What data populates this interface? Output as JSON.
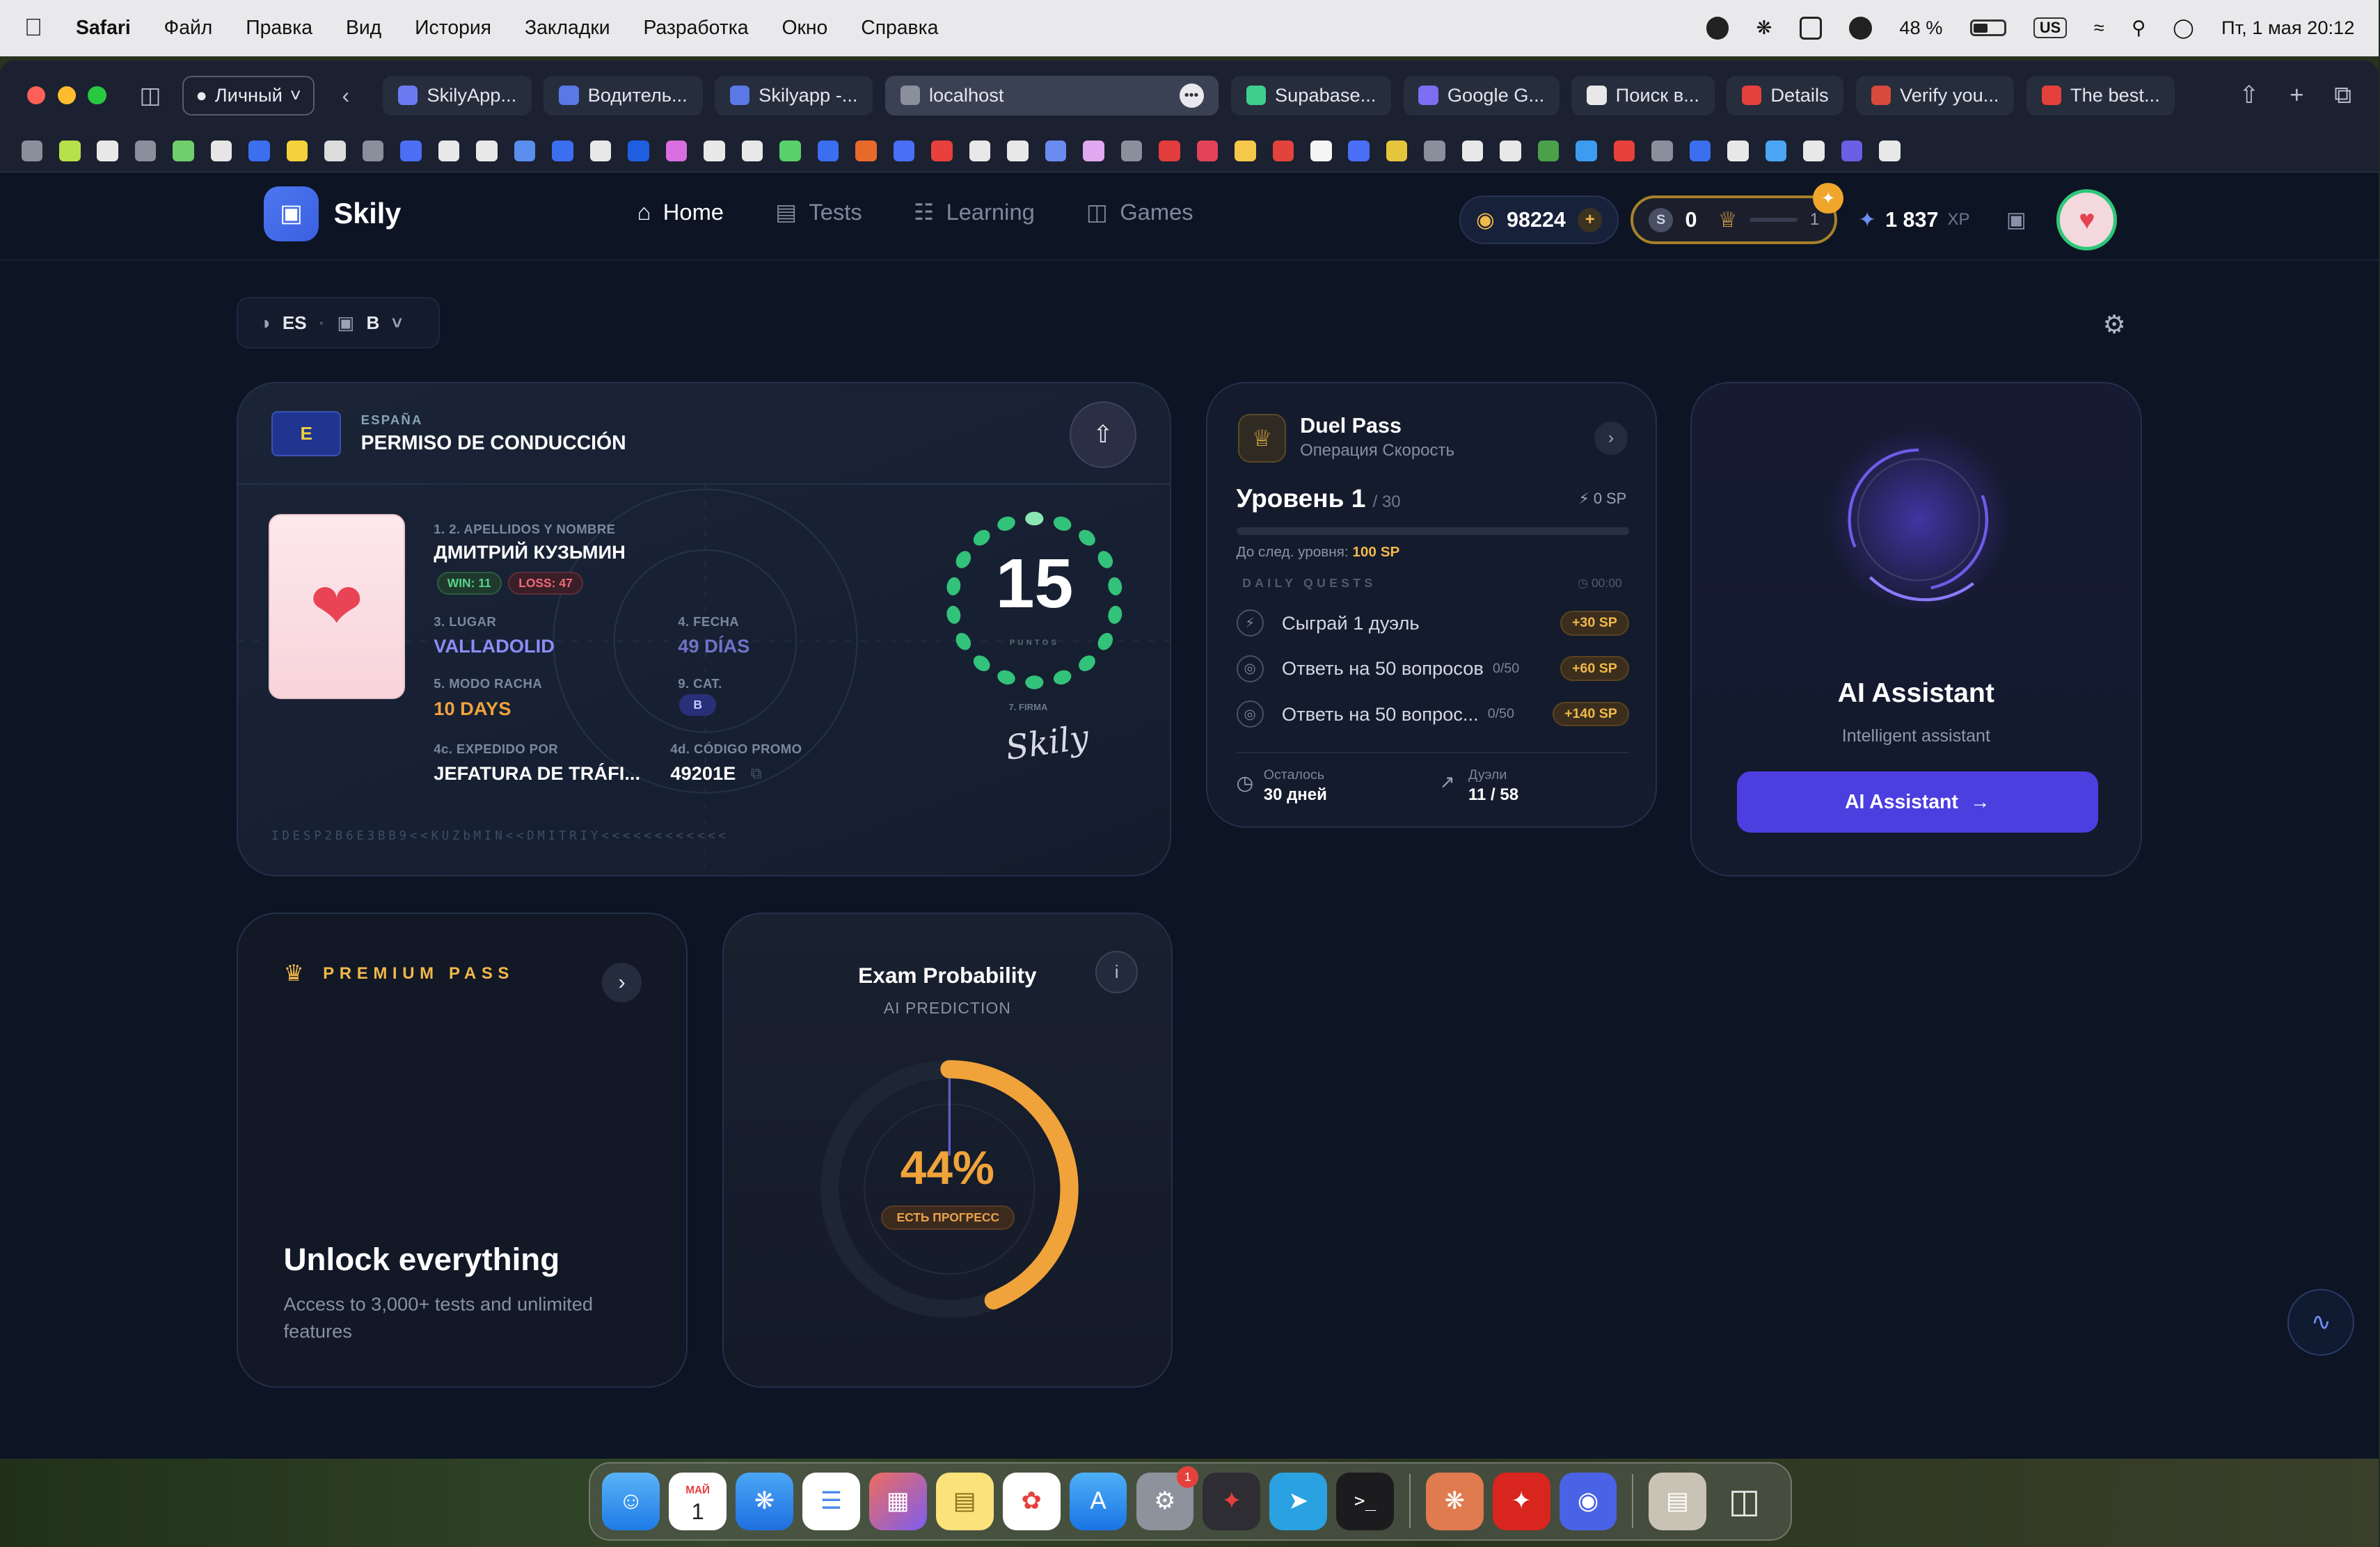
{
  "menubar": {
    "app": "Safari",
    "items": [
      "Файл",
      "Правка",
      "Вид",
      "История",
      "Закладки",
      "Разработка",
      "Окно",
      "Справка"
    ],
    "battery": "48 %",
    "keyboard": "US",
    "datetime": "Пт, 1 мая  20:12"
  },
  "browser": {
    "profile": "Личный",
    "tabs": [
      {
        "label": "SkilyApp...",
        "color": "#6a7bf2"
      },
      {
        "label": "Водитель...",
        "color": "#5a78e6"
      },
      {
        "label": "Skilyapp -...",
        "color": "#5a78e6"
      },
      {
        "label": "localhost",
        "color": "#8a8f9c",
        "active": true
      },
      {
        "label": "Supabase...",
        "color": "#3ecf8e"
      },
      {
        "label": "Google G...",
        "color": "#7c6ef2"
      },
      {
        "label": "Поиск в...",
        "color": "#e8e8e8"
      },
      {
        "label": "Details",
        "color": "#e5413c"
      },
      {
        "label": "Verify you...",
        "color": "#d84a3b"
      },
      {
        "label": "The best...",
        "color": "#e5413c"
      }
    ]
  },
  "app": {
    "brand": "Skily",
    "nav": [
      {
        "label": "Home",
        "icon": "home-icon"
      },
      {
        "label": "Tests",
        "icon": "document-icon"
      },
      {
        "label": "Learning",
        "icon": "book-icon"
      },
      {
        "label": "Games",
        "icon": "gamepad-icon"
      }
    ],
    "coins": "98224",
    "s_points": "0",
    "trophy_level": "1",
    "xp": "1 837",
    "xp_unit": "XP",
    "lang": "ES",
    "category": "B"
  },
  "license": {
    "country": "ESPAÑA",
    "title": "PERMISO DE CONDUCCIÓN",
    "eu_letter": "E",
    "name_label": "1. 2. APELLIDOS Y NOMBRE",
    "name": "ДМИТРИЙ КУЗЬМИН",
    "win": "WIN: 11",
    "loss": "LOSS: 47",
    "place_label": "3. LUGAR",
    "place": "VALLADOLID",
    "date_label": "4. FECHA",
    "date": "49 DÍAS",
    "streak_label": "5. MODO RACHA",
    "streak": "10 DAYS",
    "cat_label": "9. CAT.",
    "cat": "B",
    "issuer_label": "4c. EXPEDIDO POR",
    "issuer": "JEFATURA DE TRÁFI...",
    "promo_label": "4d. CÓDIGO PROMO",
    "promo": "49201E",
    "score": "15",
    "score_label": "PUNTOS",
    "firma_label": "7. FIRMA",
    "signature": "Skily",
    "mrz": "IDESP2B6E3BB9<<KUZbMIN<<DMITRIY<<<<<<<<<<<<"
  },
  "duel": {
    "title": "Duel Pass",
    "subtitle": "Операция Скорость",
    "level": "Уровень 1",
    "level_max": "/ 30",
    "sp": "0 SP",
    "progress": 0,
    "next_label": "До след. уровня:",
    "next_value": "100 SP",
    "quests_title": "DAILY QUESTS",
    "timer": "00:00",
    "quests": [
      {
        "text": "Сыграй 1 дуэль",
        "count": "",
        "reward": "+30 SP",
        "icon": "lightning-icon"
      },
      {
        "text": "Ответь на 50 вопросов",
        "count": "0/50",
        "reward": "+60 SP",
        "icon": "target-icon"
      },
      {
        "text": "Ответь на 50 вопрос...",
        "count": "0/50",
        "reward": "+140 SP",
        "icon": "target-icon"
      }
    ],
    "remaining_label": "Осталось",
    "remaining": "30 дней",
    "duels_label": "Дуэли",
    "duels": "11 / 58"
  },
  "ai": {
    "title": "AI Assistant",
    "subtitle": "Intelligent assistant",
    "button": "AI Assistant"
  },
  "premium": {
    "label": "PREMIUM PASS",
    "title": "Unlock everything",
    "text": "Access to 3,000+ tests and unlimited features"
  },
  "exam": {
    "title": "Exam Probability",
    "subtitle": "AI PREDICTION",
    "percent": "44%",
    "percent_value": 44,
    "badge": "ЕСТЬ ПРОГРЕСС",
    "color": "#f0a33a"
  },
  "dock": {
    "calendar_month": "МАЙ",
    "calendar_day": "1",
    "settings_badge": "1"
  }
}
